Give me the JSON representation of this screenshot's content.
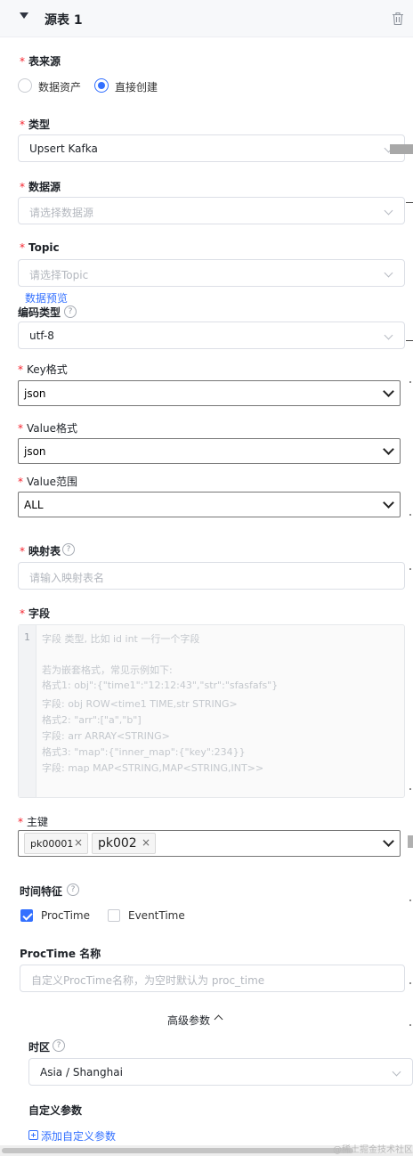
{
  "header": {
    "title": "源表 1"
  },
  "source": {
    "label": "表来源",
    "options": [
      {
        "label": "数据资产",
        "selected": false
      },
      {
        "label": "直接创建",
        "selected": true
      }
    ]
  },
  "type": {
    "label": "类型",
    "value": "Upsert Kafka"
  },
  "datasource": {
    "label": "数据源",
    "placeholder": "请选择数据源"
  },
  "topic": {
    "label": "Topic",
    "placeholder": "请选择Topic",
    "preview_link": "数据预览"
  },
  "encoding": {
    "label": "编码类型",
    "value": "utf-8"
  },
  "key_format": {
    "label": "Key格式",
    "value": "json"
  },
  "value_format": {
    "label": "Value格式",
    "value": "json"
  },
  "value_scope": {
    "label": "Value范围",
    "value": "ALL"
  },
  "mapping_table": {
    "label": "映射表",
    "placeholder": "请输入映射表名"
  },
  "fields": {
    "label": "字段",
    "line_number": "1",
    "placeholder_lines": [
      "字段 类型, 比如 id int 一行一个字段",
      "",
      "若为嵌套格式，常见示例如下:",
      "格式1: obj\":{\"time1\":\"12:12:43\",\"str\":\"sfasfafs\"}",
      "字段: obj ROW<time1 TIME,str STRING>",
      "格式2: \"arr\":[\"a\",\"b\"]",
      "字段: arr ARRAY<STRING>",
      "格式3: \"map\":{\"inner_map\":{\"key\":234}}",
      "字段: map MAP<STRING,MAP<STRING,INT>>"
    ]
  },
  "primary_key": {
    "label": "主键",
    "tags": [
      "pk00001",
      "pk002"
    ]
  },
  "time_feature": {
    "label": "时间特征",
    "options": [
      {
        "label": "ProcTime",
        "checked": true
      },
      {
        "label": "EventTime",
        "checked": false
      }
    ]
  },
  "proctime_name": {
    "label": "ProcTime 名称",
    "placeholder": "自定义ProcTime名称，为空时默认为 proc_time"
  },
  "advanced": {
    "toggle": "高级参数"
  },
  "timezone": {
    "label": "时区",
    "value": "Asia / Shanghai"
  },
  "custom_params": {
    "label": "自定义参数",
    "add_link": "添加自定义参数"
  },
  "watermark": "@稀土掘金技术社区",
  "colors": {
    "accent": "#3370ff",
    "required": "#f5222d",
    "border": "#dcdfe6"
  }
}
